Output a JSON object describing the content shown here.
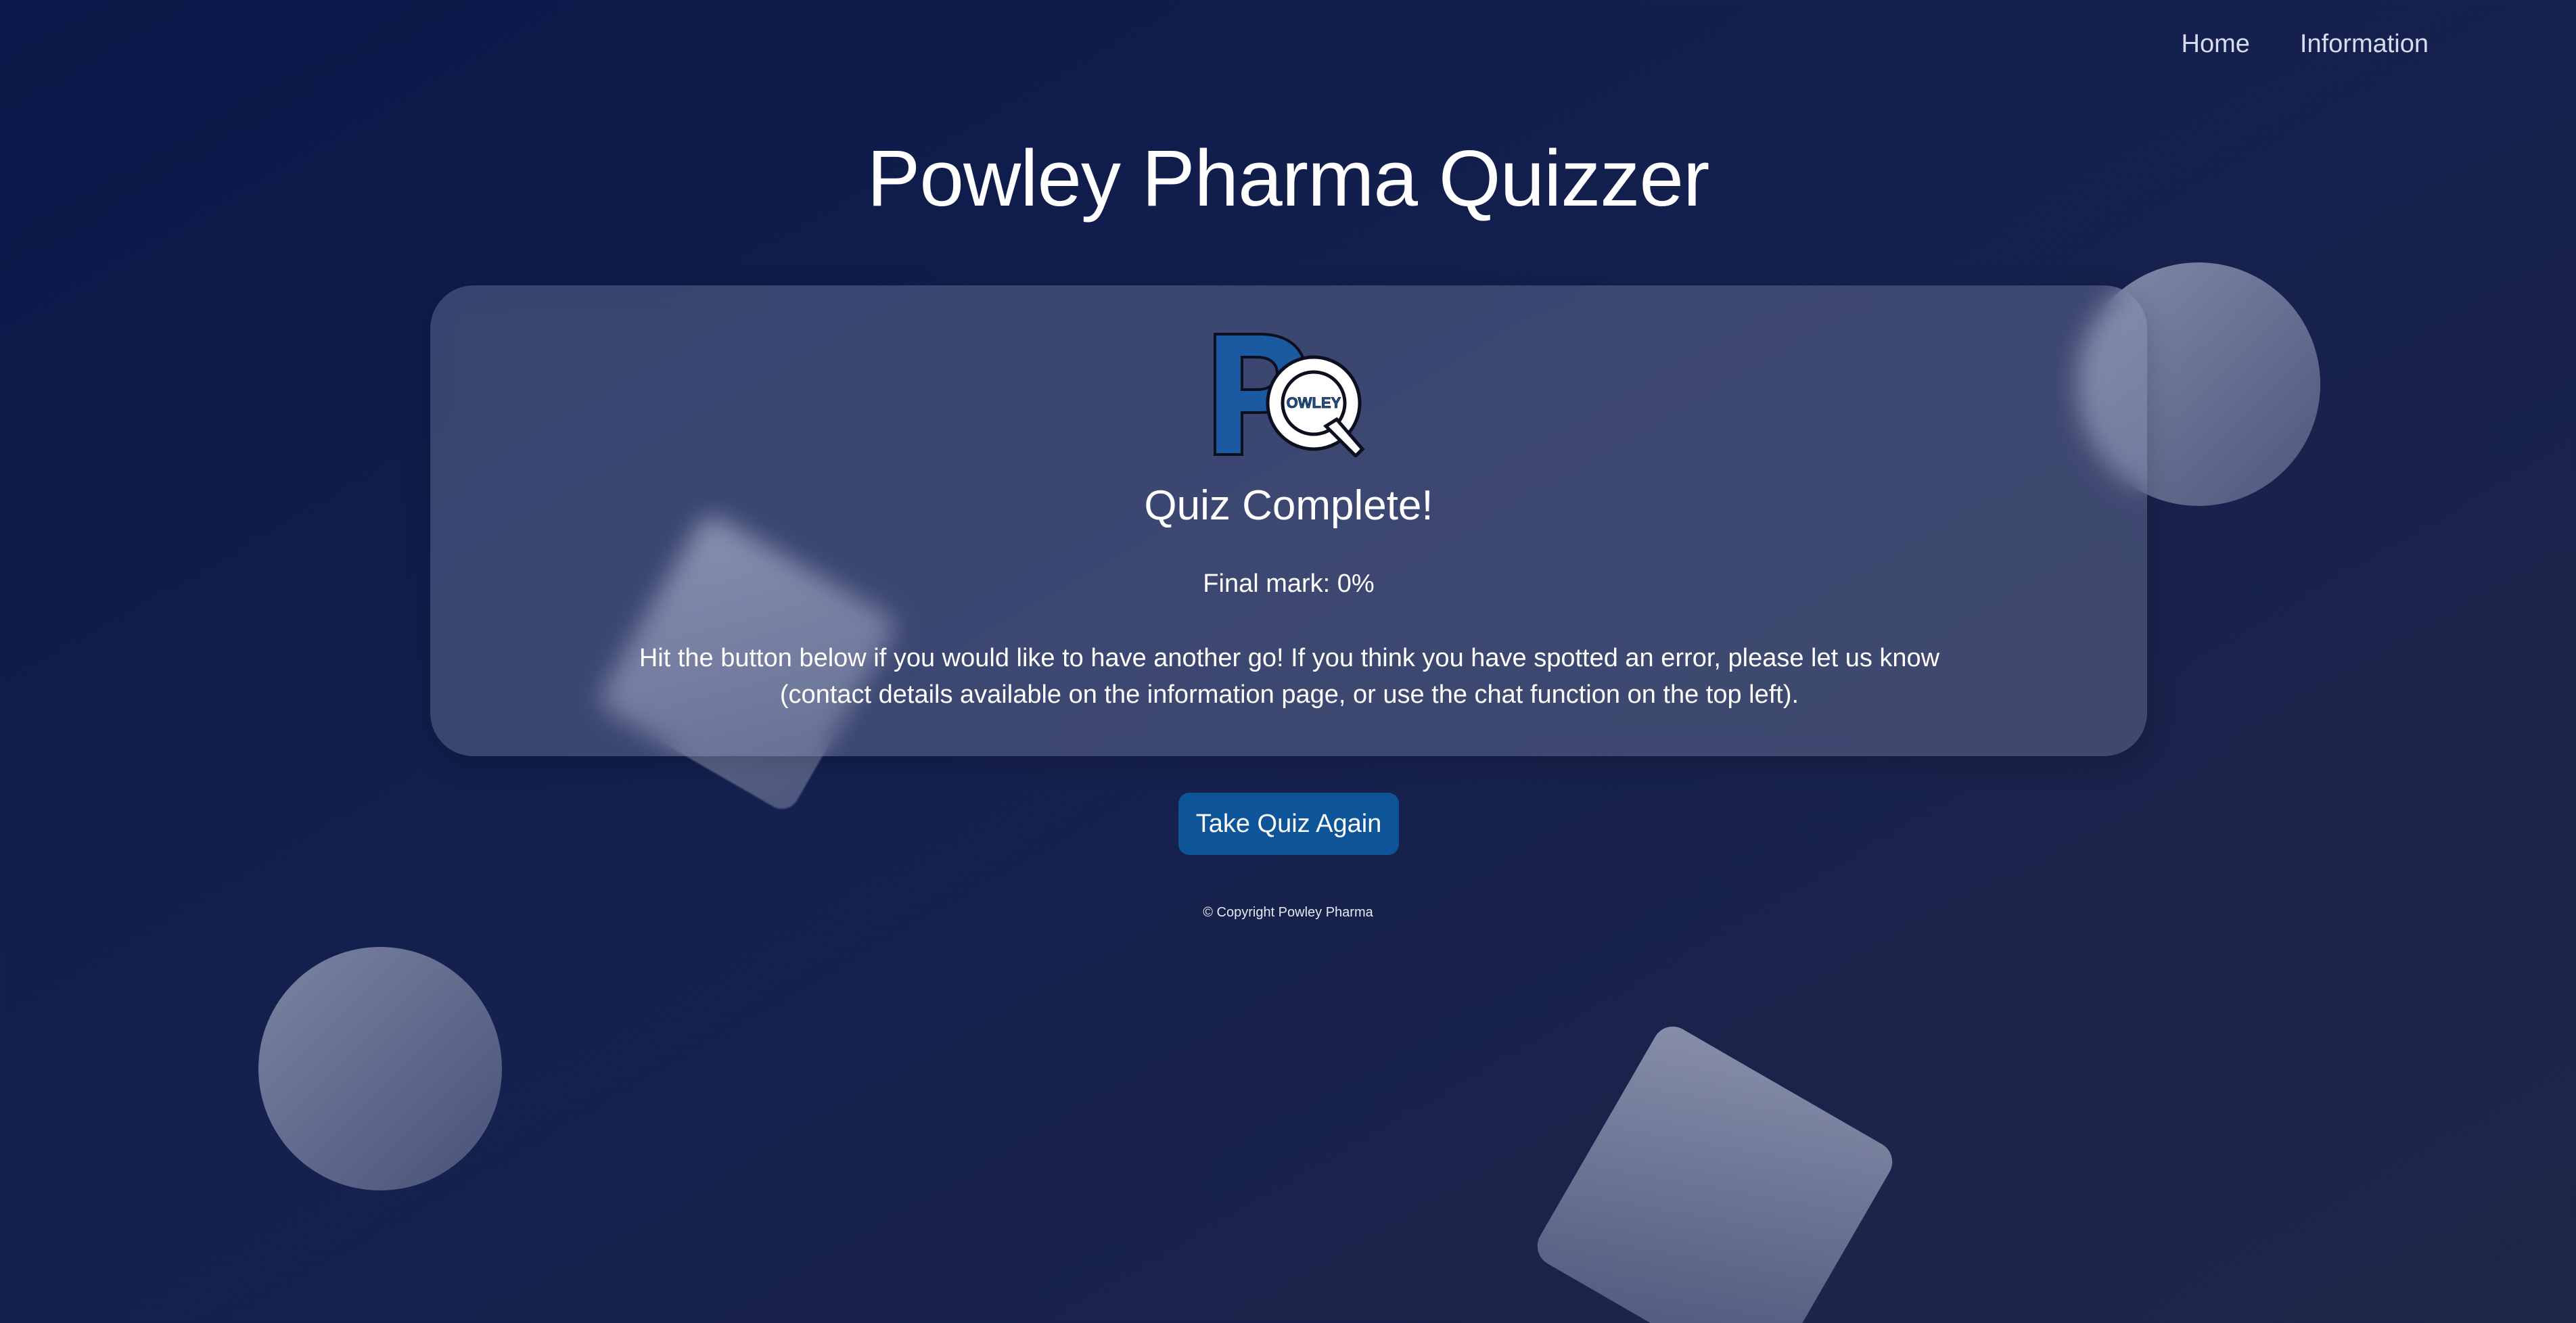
{
  "nav": {
    "items": [
      {
        "label": "Home"
      },
      {
        "label": "Information"
      }
    ]
  },
  "header": {
    "title": "Powley Pharma Quizzer"
  },
  "logo": {
    "letters": "PQ",
    "text": "OWLEY"
  },
  "result": {
    "title": "Quiz Complete!",
    "final_mark": "Final mark: 0%",
    "message": "Hit the button below if you would like to have another go! If you think you have spotted an error, please let us know (contact details available on the information page, or use the chat function on the top left)."
  },
  "actions": {
    "retake_label": "Take Quiz Again"
  },
  "footer": {
    "copyright": "© Copyright Powley Pharma"
  },
  "colors": {
    "background_start": "#0a1748",
    "background_end": "#1f2748",
    "button": "#0d5498",
    "logo_blue": "#1b5aa0"
  }
}
